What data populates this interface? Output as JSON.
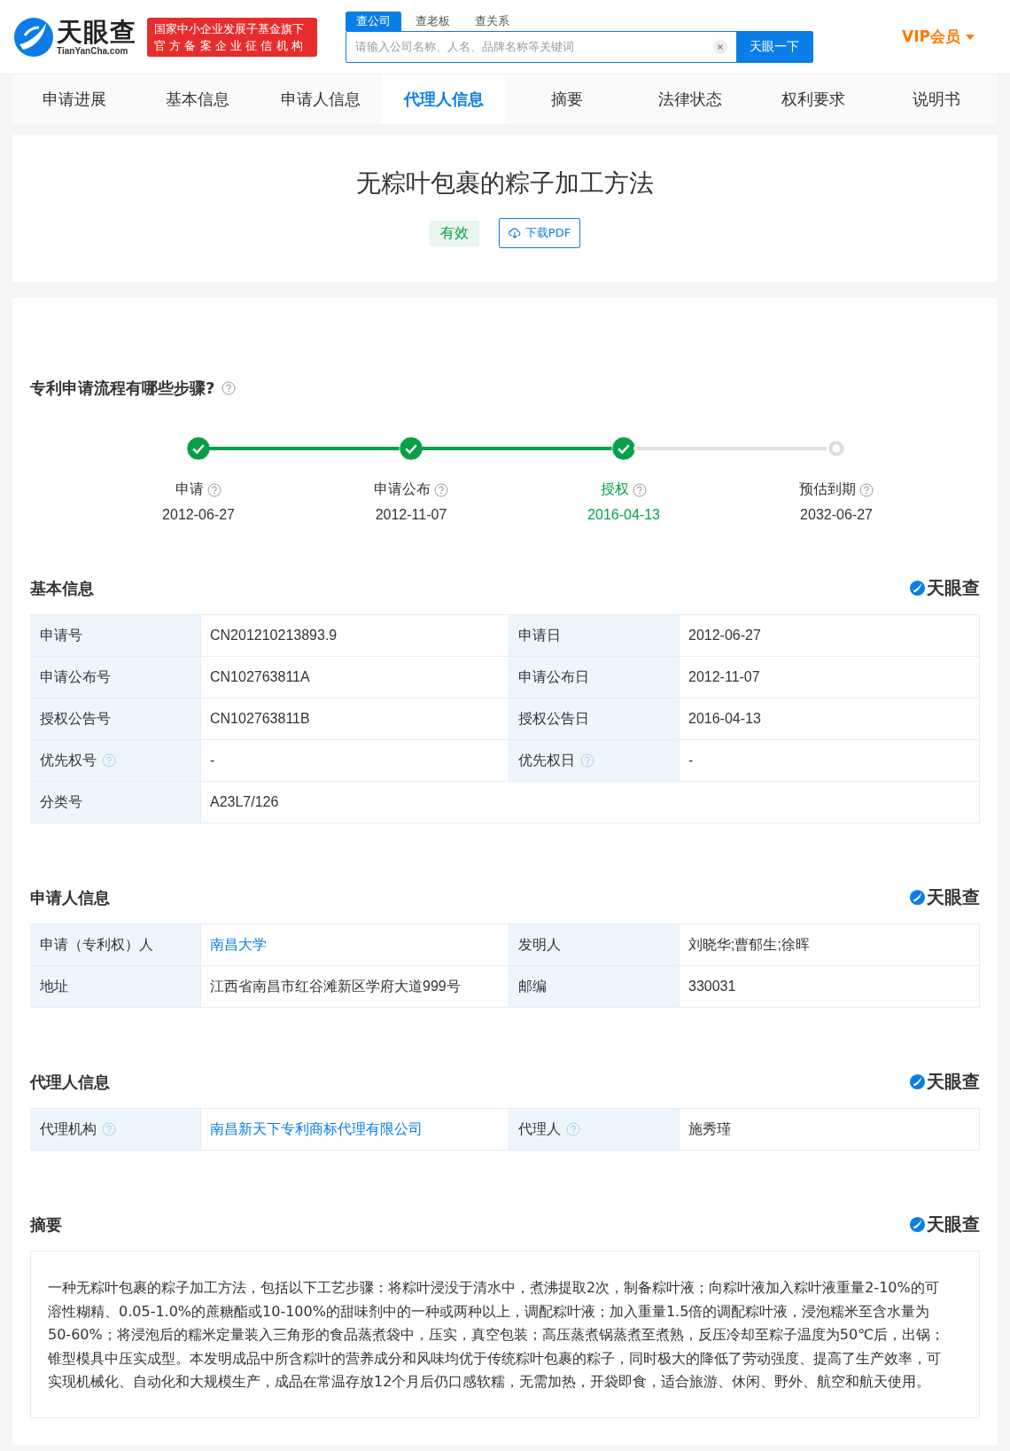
{
  "header": {
    "logo": {
      "name": "天眼查",
      "domain": "TianYanCha.com"
    },
    "badge": [
      "国家中小企业发展子基金旗下",
      "官方备案企业征信机构"
    ],
    "search": {
      "tabs": [
        {
          "label": "查公司",
          "selected": true
        },
        {
          "label": "查老板",
          "selected": false
        },
        {
          "label": "查关系",
          "selected": false
        }
      ],
      "placeholder": "请输入公司名称、人名、品牌名称等关键词",
      "button": "天眼一下"
    },
    "vip": "VIP会员"
  },
  "nav": [
    {
      "label": "申请进展",
      "selected": false
    },
    {
      "label": "基本信息",
      "selected": false
    },
    {
      "label": "申请人信息",
      "selected": false
    },
    {
      "label": "代理人信息",
      "selected": true
    },
    {
      "label": "摘要",
      "selected": false
    },
    {
      "label": "法律状态",
      "selected": false
    },
    {
      "label": "权利要求",
      "selected": false
    },
    {
      "label": "说明书",
      "selected": false
    }
  ],
  "patent": {
    "title": "无粽叶包裹的粽子加工方法",
    "status": "有效",
    "download": "下载PDF"
  },
  "progress": {
    "title": "专利申请流程有哪些步骤?",
    "steps": [
      {
        "label": "申请",
        "date": "2012-06-27",
        "done": true,
        "selected": false
      },
      {
        "label": "申请公布",
        "date": "2012-11-07",
        "done": true,
        "selected": false
      },
      {
        "label": "授权",
        "date": "2016-04-13",
        "done": true,
        "selected": true
      },
      {
        "label": "预估到期",
        "date": "2032-06-27",
        "done": false,
        "selected": false
      }
    ]
  },
  "sections": [
    {
      "title": "基本信息",
      "brand": "天眼查",
      "rows": [
        [
          {
            "label": "申请号",
            "help": false,
            "value": "CN201210213893.9",
            "link": false
          },
          {
            "label": "申请日",
            "help": false,
            "value": "2012-06-27",
            "link": false
          }
        ],
        [
          {
            "label": "申请公布号",
            "help": false,
            "value": "CN102763811A",
            "link": false
          },
          {
            "label": "申请公布日",
            "help": false,
            "value": "2012-11-07",
            "link": false
          }
        ],
        [
          {
            "label": "授权公告号",
            "help": false,
            "value": "CN102763811B",
            "link": false
          },
          {
            "label": "授权公告日",
            "help": false,
            "value": "2016-04-13",
            "link": false
          }
        ],
        [
          {
            "label": "优先权号",
            "help": true,
            "value": "-",
            "link": false
          },
          {
            "label": "优先权日",
            "help": true,
            "value": "-",
            "link": false
          }
        ],
        [
          {
            "label": "分类号",
            "help": false,
            "value": "A23L7/126",
            "link": false
          }
        ]
      ]
    },
    {
      "title": "申请人信息",
      "brand": "天眼查",
      "rows": [
        [
          {
            "label": "申请（专利权）人",
            "help": false,
            "value": "南昌大学",
            "link": true
          },
          {
            "label": "发明人",
            "help": false,
            "value": "刘晓华;曹郁生;徐晖",
            "link": false
          }
        ],
        [
          {
            "label": "地址",
            "help": false,
            "value": "江西省南昌市红谷滩新区学府大道999号",
            "link": false
          },
          {
            "label": "邮编",
            "help": false,
            "value": "330031",
            "link": false
          }
        ]
      ]
    },
    {
      "title": "代理人信息",
      "brand": "天眼查",
      "rows": [
        [
          {
            "label": "代理机构",
            "help": true,
            "value": "南昌新天下专利商标代理有限公司",
            "link": true
          },
          {
            "label": "代理人",
            "help": true,
            "value": "施秀瑾",
            "link": false
          }
        ]
      ]
    }
  ],
  "abstract": {
    "title": "摘要",
    "brand": "天眼查",
    "text": "一种无粽叶包裹的粽子加工方法，包括以下工艺步骤：将粽叶浸没于清水中，煮沸提取2次，制备粽叶液；向粽叶液加入粽叶液重量2-10%的可溶性糊精、0.05-1.0%的蔗糖酯或10-100%的甜味剂中的一种或两种以上，调配粽叶液；加入重量1.5倍的调配粽叶液，浸泡糯米至含水量为50-60%；将浸泡后的糯米定量装入三角形的食品蒸煮袋中，压实，真空包装；高压蒸煮锅蒸煮至煮熟，反压冷却至粽子温度为50℃后，出锅；锥型模具中压实成型。本发明成品中所含粽叶的营养成分和风味均优于传统粽叶包裹的粽子，同时极大的降低了劳动强度、提高了生产效率，可实现机械化、自动化和大规模生产，成品在常温存放12个月后仍口感软糯，无需加热，开袋即食，适合旅游、休闲、野外、航空和航天使用。"
  }
}
